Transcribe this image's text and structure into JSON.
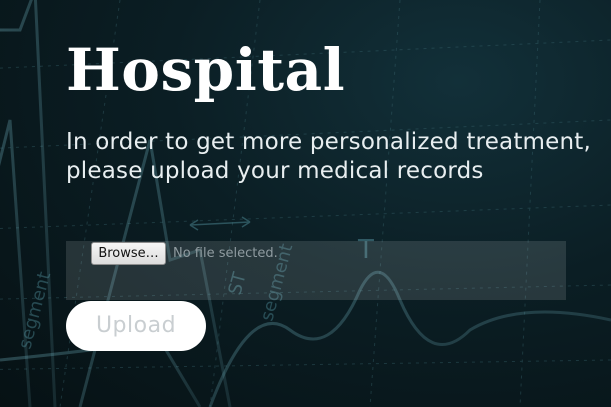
{
  "page": {
    "title": "Hospital",
    "subtitle_line1": "In order to get more personalized treatment,",
    "subtitle_line2": "please upload your medical records"
  },
  "file_input": {
    "browse_label": "Browse…",
    "status_text": "No file selected."
  },
  "upload": {
    "label": "Upload"
  },
  "background": {
    "annotation_t": "T",
    "annotation_st": "ST",
    "annotation_segment_1": "segment",
    "annotation_segment_2": "segment",
    "colors": {
      "base": "#0a1a1f",
      "trace": "#4e8a96"
    }
  }
}
